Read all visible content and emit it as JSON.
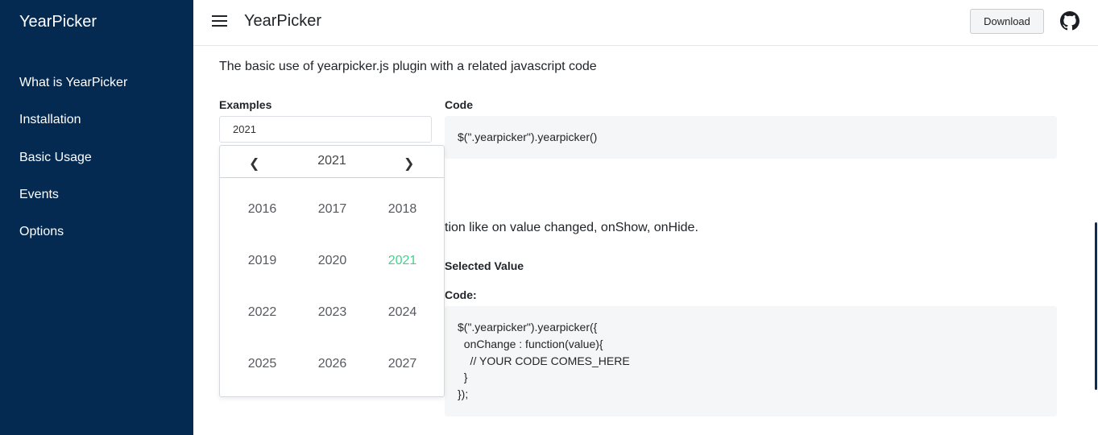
{
  "sidebar": {
    "brand": "YearPicker",
    "items": [
      {
        "label": "What is YearPicker"
      },
      {
        "label": "Installation"
      },
      {
        "label": "Basic Usage"
      },
      {
        "label": "Events"
      },
      {
        "label": "Options"
      }
    ]
  },
  "header": {
    "title": "YearPicker",
    "download_label": "Download",
    "menu_icon": "hamburger-menu-icon",
    "github_icon": "github-icon"
  },
  "main": {
    "intro": "The basic use of yearpicker.js plugin with a related javascript code",
    "examples_label": "Examples",
    "code_label": "Code",
    "input_value": "2021",
    "code1": "$(\".yearpicker\").yearpicker()",
    "events_desc_partial": "tion like on value changed, onShow, onHide.",
    "selected_value_label": "Selected Value",
    "code2_label": "Code:",
    "code2": "$(\".yearpicker\").yearpicker({\n  onChange : function(value){\n    // YOUR CODE COMES_HERE\n  }\n});"
  },
  "picker": {
    "prev": "❮",
    "next": "❯",
    "current_year": "2021",
    "selected_year": "2021",
    "selected_color": "#3fd38b",
    "years": [
      "2016",
      "2017",
      "2018",
      "2019",
      "2020",
      "2021",
      "2022",
      "2023",
      "2024",
      "2025",
      "2026",
      "2027"
    ]
  },
  "colors": {
    "sidebar_bg": "#042a52",
    "code_bg": "#f5f6f7"
  }
}
